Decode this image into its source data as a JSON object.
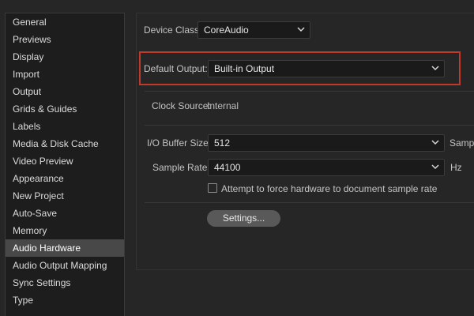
{
  "sidebar": {
    "items": [
      {
        "label": "General"
      },
      {
        "label": "Previews"
      },
      {
        "label": "Display"
      },
      {
        "label": "Import"
      },
      {
        "label": "Output"
      },
      {
        "label": "Grids & Guides"
      },
      {
        "label": "Labels"
      },
      {
        "label": "Media & Disk Cache"
      },
      {
        "label": "Video Preview"
      },
      {
        "label": "Appearance"
      },
      {
        "label": "New Project"
      },
      {
        "label": "Auto-Save"
      },
      {
        "label": "Memory"
      },
      {
        "label": "Audio Hardware"
      },
      {
        "label": "Audio Output Mapping"
      },
      {
        "label": "Sync Settings"
      },
      {
        "label": "Type"
      }
    ],
    "selected": "Audio Hardware"
  },
  "device_class": {
    "label": "Device Class:",
    "value": "CoreAudio"
  },
  "default_output": {
    "label": "Default Output:",
    "value": "Built-in Output"
  },
  "clock_source": {
    "label": "Clock Source:",
    "value": "Internal"
  },
  "io_buffer": {
    "label": "I/O Buffer Size:",
    "value": "512",
    "unit": "Sampl"
  },
  "sample_rate": {
    "label": "Sample Rate:",
    "value": "44100",
    "unit": "Hz"
  },
  "force_rate": {
    "label": "Attempt to force hardware to document sample rate",
    "checked": false
  },
  "settings_button": {
    "label": "Settings..."
  },
  "colors": {
    "highlight": "#c0392b",
    "selected_item": "#484848",
    "background": "#262626"
  },
  "icons": {
    "dropdown": "chevron-down-icon"
  }
}
